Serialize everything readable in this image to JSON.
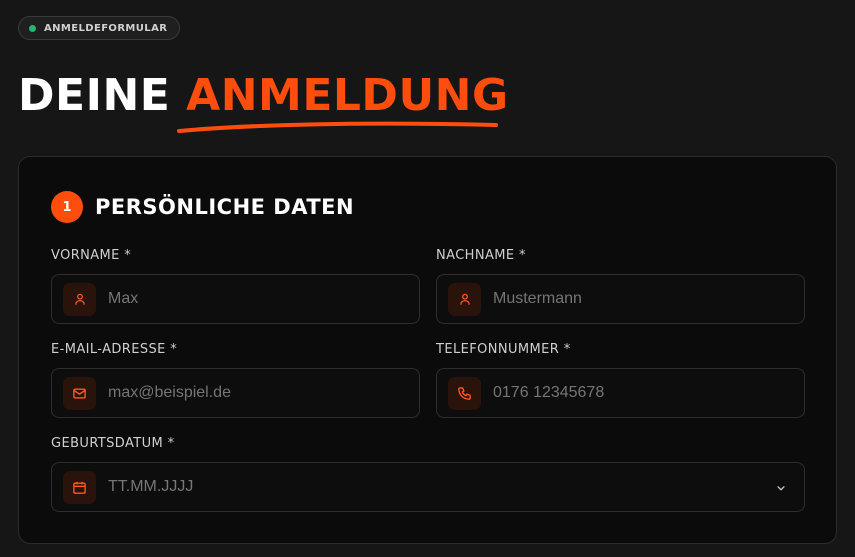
{
  "badge": {
    "label": "ANMELDEFORMULAR",
    "dot_color": "#22b573"
  },
  "header": {
    "title_plain": "DEINE",
    "title_accent": "ANMELDUNG",
    "accent_color": "#ff4d0d"
  },
  "section": {
    "number": "1",
    "title": "PERSÖNLICHE DATEN",
    "fields": {
      "first_name": {
        "label": "VORNAME *",
        "placeholder": "Max",
        "icon": "user-icon"
      },
      "last_name": {
        "label": "NACHNAME *",
        "placeholder": "Mustermann",
        "icon": "user-icon"
      },
      "email": {
        "label": "E-MAIL-ADRESSE *",
        "placeholder": "max@beispiel.de",
        "icon": "mail-icon"
      },
      "phone": {
        "label": "TELEFONNUMMER *",
        "placeholder": "0176 12345678",
        "icon": "phone-icon"
      },
      "birthdate": {
        "label": "GEBURTSDATUM *",
        "placeholder": "TT.MM.JJJJ",
        "icon": "calendar-icon"
      }
    }
  }
}
